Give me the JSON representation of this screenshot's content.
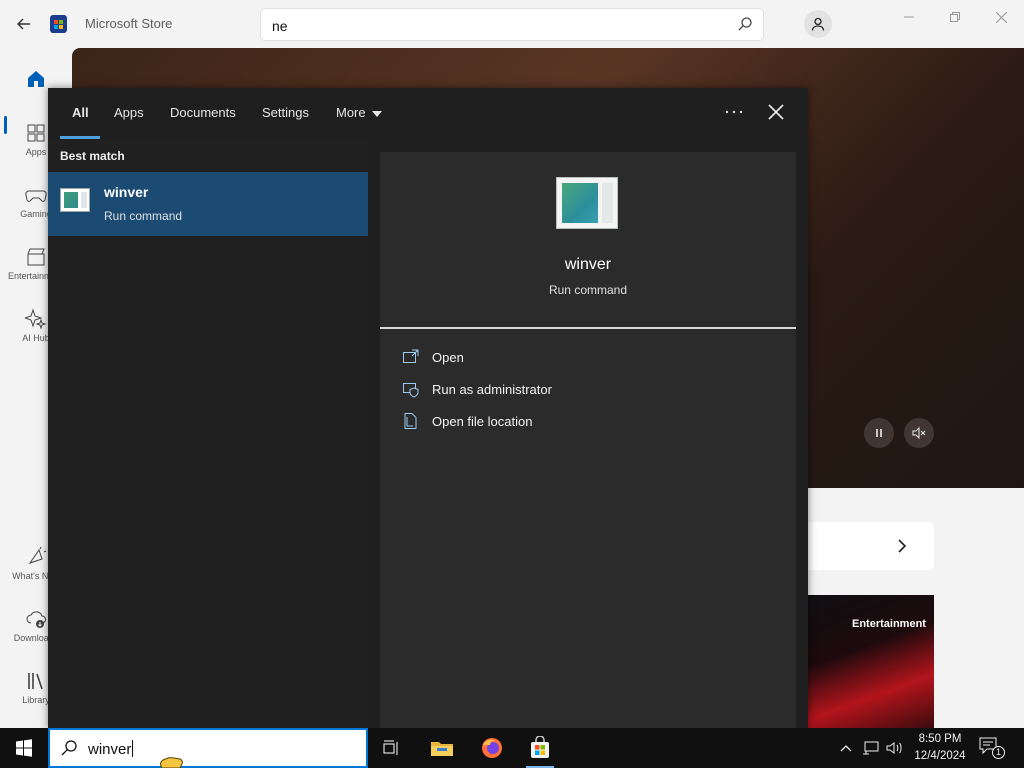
{
  "store": {
    "title": "Microsoft Store",
    "search_value": "ne",
    "nav": [
      {
        "label": "Apps",
        "icon": "apps-icon"
      },
      {
        "label": "Gaming",
        "icon": "gaming-icon"
      },
      {
        "label": "Entertainment",
        "icon": "entertainment-icon"
      },
      {
        "label": "AI Hub",
        "icon": "ai-hub-icon"
      },
      {
        "label": "What's New",
        "icon": "whats-new-icon"
      },
      {
        "label": "Downloads",
        "icon": "downloads-icon"
      },
      {
        "label": "Library",
        "icon": "library-icon"
      }
    ],
    "entertainment_tile_title": "Entertainment"
  },
  "search": {
    "tabs": [
      {
        "label": "All",
        "active": true
      },
      {
        "label": "Apps"
      },
      {
        "label": "Documents"
      },
      {
        "label": "Settings"
      },
      {
        "label": "More"
      }
    ],
    "best_match_header": "Best match",
    "best_match": {
      "name": "winver",
      "type": "Run command"
    },
    "preview": {
      "name": "winver",
      "type": "Run command",
      "actions": [
        {
          "label": "Open",
          "icon": "open-icon"
        },
        {
          "label": "Run as administrator",
          "icon": "shield-admin-icon"
        },
        {
          "label": "Open file location",
          "icon": "file-location-icon"
        }
      ]
    }
  },
  "taskbar": {
    "search_text": "winver",
    "apps": [
      "task-view-icon",
      "file-explorer-icon",
      "firefox-icon",
      "microsoft-store-icon"
    ],
    "time": "8:50 PM",
    "date": "12/4/2024",
    "notification_count": "1"
  },
  "colors": {
    "accent": "#0078d4",
    "selected_result": "#1b4a72",
    "panel_bg": "#1f1f1f"
  }
}
